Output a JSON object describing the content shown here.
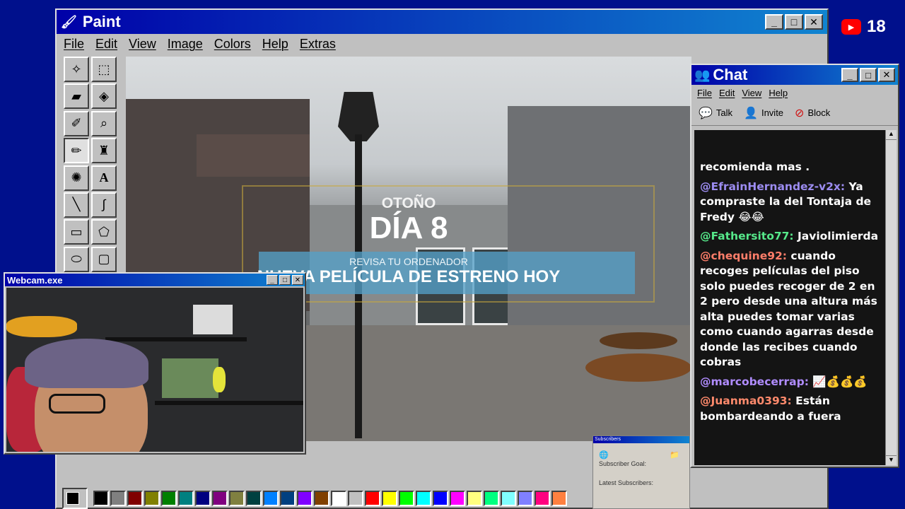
{
  "paint": {
    "title": "Paint",
    "menu": [
      "File",
      "Edit",
      "View",
      "Image",
      "Colors",
      "Help",
      "Extras"
    ],
    "tools": [
      "free-select",
      "rect-select",
      "eraser",
      "fill",
      "color-picker",
      "magnifier",
      "pencil",
      "brush",
      "airbrush",
      "text",
      "line",
      "curve",
      "rectangle",
      "polygon",
      "ellipse",
      "rounded-rect"
    ],
    "palette": [
      "#000000",
      "#808080",
      "#800000",
      "#808000",
      "#008000",
      "#008080",
      "#000080",
      "#800080",
      "#808040",
      "#004040",
      "#0080ff",
      "#004080",
      "#8000ff",
      "#804000",
      "#ffffff",
      "#c0c0c0",
      "#ff0000",
      "#ffff00",
      "#00ff00",
      "#00ffff",
      "#0000ff",
      "#ff00ff",
      "#ffff80",
      "#00ff80",
      "#80ffff",
      "#8080ff",
      "#ff0080",
      "#ff8040"
    ]
  },
  "game": {
    "season": "OTOÑO",
    "day": "DÍA 8",
    "check": "REVISA TU ORDENADOR",
    "movie": "NUEVA PELÍCULA DE ESTRENO HOY"
  },
  "webcam": {
    "title": "Webcam.exe"
  },
  "subscribers": {
    "title": "Subscribers",
    "goal_label": "Subscriber Goal:",
    "latest_label": "Latest Subscribers:"
  },
  "chat": {
    "title": "Chat",
    "menu": [
      "File",
      "Edit",
      "View",
      "Help"
    ],
    "actions": {
      "talk": "Talk",
      "invite": "Invite",
      "block": "Block"
    },
    "messages": [
      {
        "user": "",
        "text": "recomienda mas ."
      },
      {
        "user": "@EfrainHernandez-v2x:",
        "text": "Ya compraste la del Tontaja de Fredy 😂😂"
      },
      {
        "user": "@Fathersito77:",
        "text": "Javiolimierda"
      },
      {
        "user": "@chequine92:",
        "text": "cuando recoges películas del piso solo puedes recoger de 2 en 2 pero desde una altura más alta puedes tomar varias como cuando agarras desde donde las recibes cuando cobras"
      },
      {
        "user": "@marcobecerrap:",
        "text": "📈💰💰💰"
      },
      {
        "user": "@Juanma0393:",
        "text": "Están bombardeando a fuera"
      }
    ]
  },
  "youtube": {
    "count": "18"
  }
}
